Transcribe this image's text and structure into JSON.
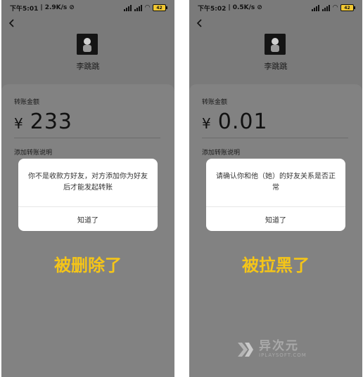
{
  "screens": [
    {
      "status": {
        "time": "下午5:01",
        "speed": "2.9K/s",
        "battery": "42"
      },
      "recipient_name": "李跳跳",
      "amount_label": "转账金额",
      "currency": "¥",
      "amount": "233",
      "note_link": "添加转账说明",
      "dialog": {
        "message": "你不是收款方好友，对方添加你为好友后才能发起转账",
        "button": "知道了"
      },
      "caption": "被删除了"
    },
    {
      "status": {
        "time": "下午5:02",
        "speed": "0.5K/s",
        "battery": "42"
      },
      "recipient_name": "李跳跳",
      "amount_label": "转账金额",
      "currency": "¥",
      "amount": "0.01",
      "note_link": "添加转账说明",
      "dialog": {
        "message": "请确认你和他（她）的好友关系是否正常",
        "button": "知道了"
      },
      "caption": "被拉黑了"
    }
  ],
  "watermark": {
    "cn": "异次元",
    "en": "IPLAYSOFT.COM"
  },
  "colors": {
    "caption": "#f5c518",
    "screen_dim": "#7a7a7a",
    "battery": "#f2c832"
  }
}
